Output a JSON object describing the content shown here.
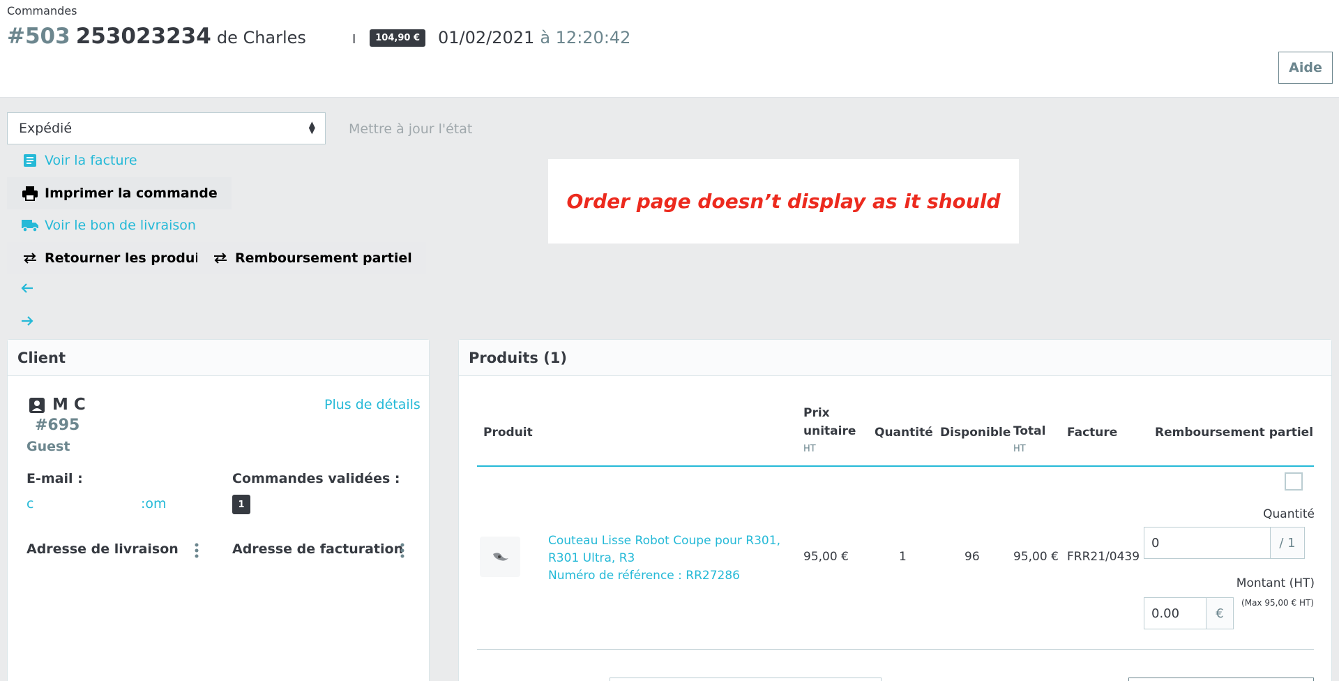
{
  "header": {
    "breadcrumb": "Commandes",
    "order_number": "#503",
    "order_reference": "253023234",
    "customer_prefix": "de Charles",
    "separator": "I",
    "total_badge": "104,90 €",
    "date": "01/02/2021",
    "time": "à 12:20:42",
    "help_label": "Aide"
  },
  "status": {
    "selected": "Expédié",
    "update_label": "Mettre à jour l'état"
  },
  "actions": {
    "view_invoice": "Voir la facture",
    "print_order": "Imprimer la commande",
    "view_delivery_slip": "Voir le bon de livraison",
    "return_products": "Retourner les produits",
    "partial_refund": "Remboursement partiel"
  },
  "notice": {
    "text": "Order page doesn’t display as it should"
  },
  "client": {
    "title": "Client",
    "name": "M C",
    "id": "#695",
    "type": "Guest",
    "details_link": "Plus de détails",
    "email_label": "E-mail :",
    "email_start": "c",
    "email_end": ":om",
    "validated_orders_label": "Commandes validées :",
    "validated_orders_count": "1",
    "shipping_address_label": "Adresse de livraison",
    "billing_address_label": "Adresse de facturation"
  },
  "products": {
    "title": "Produits (1)",
    "columns": {
      "product": "Produit",
      "unit_price": "Prix unitaire",
      "unit_price_sub": "HT",
      "quantity": "Quantité",
      "available": "Disponible",
      "total": "Total",
      "total_sub": "HT",
      "invoice": "Facture",
      "partial_refund": "Remboursement partiel"
    },
    "rows": [
      {
        "name_line1": "Couteau Lisse Robot Coupe pour R301,",
        "name_line2": "R301 Ultra, R3",
        "reference": "Numéro de référence : RR27286",
        "unit_price": "95,00 €",
        "quantity": "1",
        "available": "96",
        "total": "95,00 €",
        "invoice": "FRR21/0439",
        "refund_qty_label": "Quantité",
        "refund_qty_value": "0",
        "refund_qty_max": "/ 1",
        "refund_amount_label": "Montant (HT)",
        "refund_amount_max": "(Max 95,00 € HT)",
        "refund_amount_value": "0.00",
        "currency": "€"
      }
    ]
  },
  "colors": {
    "accent": "#25b9d7",
    "notice": "#ec2a1e",
    "dark": "#363a41",
    "muted": "#6c868e"
  }
}
